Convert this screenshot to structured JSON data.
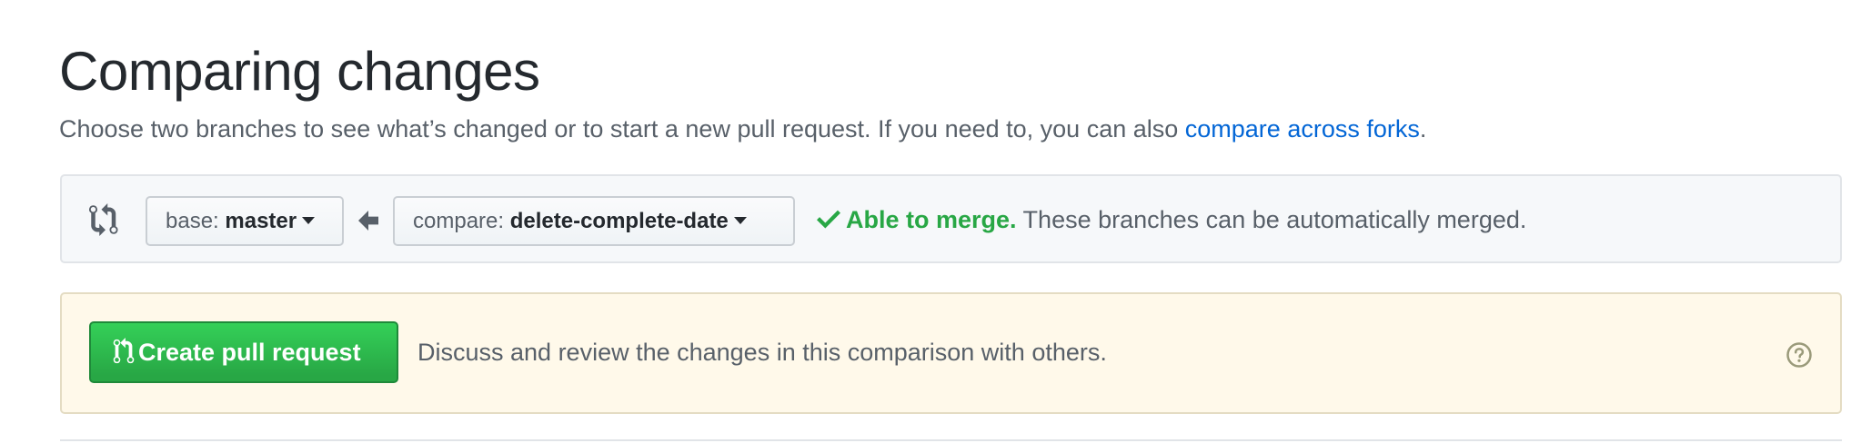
{
  "header": {
    "title": "Comparing changes",
    "subtitle_text": "Choose two branches to see what’s changed or to start a new pull request. If you need to, you can also ",
    "subtitle_link": "compare across forks",
    "subtitle_end": "."
  },
  "range_editor": {
    "base": {
      "prefix": "base: ",
      "branch": "master"
    },
    "compare": {
      "prefix": "compare: ",
      "branch": "delete-complete-date"
    },
    "merge_status": {
      "label": "Able to merge.",
      "description": " These branches can be automatically merged."
    }
  },
  "pr": {
    "button_label": "Create pull request",
    "help_text": "Discuss and review the changes in this comparison with others."
  },
  "icons": {
    "compare": "git-compare-icon",
    "arrow": "arrow-left-icon",
    "check": "check-icon",
    "pull_request": "git-pull-request-icon",
    "help": "question-icon"
  },
  "colors": {
    "link": "#0366d6",
    "success": "#28a745",
    "button_green": "#2cbe4e",
    "notice_bg": "#fff9ea",
    "panel_bg": "#f6f8fa"
  }
}
